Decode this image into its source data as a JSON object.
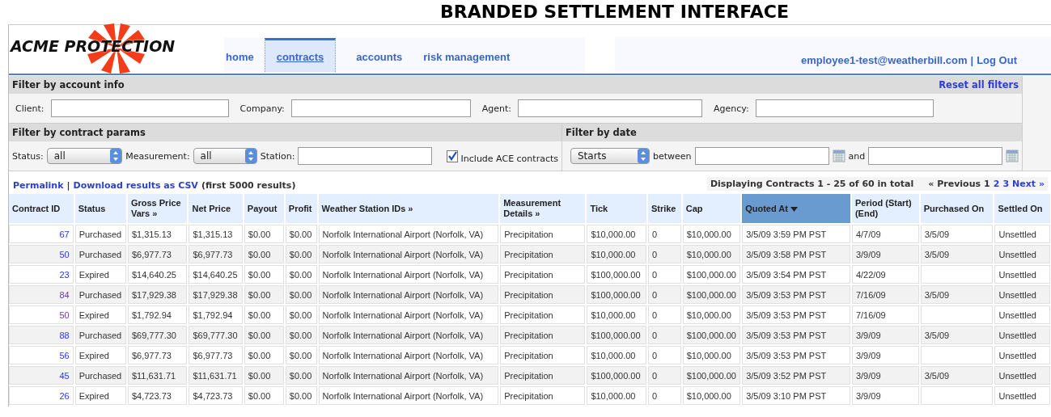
{
  "page_title": "BRANDED SETTLEMENT INTERFACE",
  "header": {
    "logo": "ACME PROTECTION",
    "tabs": [
      {
        "label": "home",
        "selected": false
      },
      {
        "label": "contracts",
        "selected": true
      },
      {
        "label": "accounts",
        "selected": false
      },
      {
        "label": "risk management",
        "selected": false
      }
    ],
    "user": "employee1-test@weatherbill.com",
    "logout": "Log Out"
  },
  "account_filter": {
    "title": "Filter by account info",
    "reset": "Reset all filters",
    "fields": [
      {
        "label": "Client:"
      },
      {
        "label": "Company:"
      },
      {
        "label": "Agent:"
      },
      {
        "label": "Agency:"
      }
    ]
  },
  "contract_filter": {
    "title": "Filter by contract params",
    "status_label": "Status:",
    "status_value": "all",
    "measurement_label": "Measurement:",
    "measurement_value": "all",
    "station_label": "Station:",
    "include_label": "Include ACE contracts",
    "include_checked": true
  },
  "date_filter": {
    "title": "Filter by date",
    "mode": "Starts",
    "between": "between",
    "and": "and"
  },
  "results": {
    "permalink": "Permalink",
    "separator": "|",
    "download": "Download results as CSV",
    "note": "(first 5000 results)",
    "summary": "Displaying Contracts 1 - 25 of 60 in total",
    "pages": [
      {
        "label": "« Previous",
        "link": false
      },
      {
        "label": "1",
        "link": false
      },
      {
        "label": "2",
        "link": true
      },
      {
        "label": "3",
        "link": true
      },
      {
        "label": "Next »",
        "link": true
      }
    ]
  },
  "table": {
    "columns": [
      {
        "label": "Contract ID",
        "selected": false
      },
      {
        "label": "Status",
        "selected": false
      },
      {
        "label": "Gross Price Vars »",
        "selected": false
      },
      {
        "label": "Net Price",
        "selected": false
      },
      {
        "label": "Payout",
        "selected": false
      },
      {
        "label": "Profit",
        "selected": false
      },
      {
        "label": "Weather Station IDs »",
        "selected": false
      },
      {
        "label": "Measurement Details »",
        "selected": false
      },
      {
        "label": "Tick",
        "selected": false
      },
      {
        "label": "Strike",
        "selected": false
      },
      {
        "label": "Cap",
        "selected": false
      },
      {
        "label": "Quoted At",
        "selected": true
      },
      {
        "label": "Period (Start) (End)",
        "selected": false
      },
      {
        "label": "Purchased On",
        "selected": false
      },
      {
        "label": "Settled On",
        "selected": false
      }
    ],
    "rows": [
      {
        "visited": false,
        "cells": [
          "67",
          "Purchased",
          "$1,315.13",
          "$1,315.13",
          "$0.00",
          "$0.00",
          "Norfolk International Airport (Norfolk, VA)",
          "Precipitation",
          "$10,000.00",
          "0",
          "$10,000.00",
          "3/5/09 3:59 PM PST",
          "4/7/09",
          "3/5/09",
          "Unsettled"
        ]
      },
      {
        "visited": false,
        "cells": [
          "50",
          "Purchased",
          "$6,977.73",
          "$6,977.73",
          "$0.00",
          "$0.00",
          "Norfolk International Airport (Norfolk, VA)",
          "Precipitation",
          "$10,000.00",
          "0",
          "$10,000.00",
          "3/5/09 3:58 PM PST",
          "3/9/09",
          "3/5/09",
          "Unsettled"
        ]
      },
      {
        "visited": false,
        "cells": [
          "23",
          "Expired",
          "$14,640.25",
          "$14,640.25",
          "$0.00",
          "$0.00",
          "Norfolk International Airport (Norfolk, VA)",
          "Precipitation",
          "$100,000.00",
          "0",
          "$100,000.00",
          "3/5/09 3:54 PM PST",
          "4/22/09",
          "",
          "Unsettled"
        ]
      },
      {
        "visited": true,
        "cells": [
          "84",
          "Purchased",
          "$17,929.38",
          "$17,929.38",
          "$0.00",
          "$0.00",
          "Norfolk International Airport (Norfolk, VA)",
          "Precipitation",
          "$100,000.00",
          "0",
          "$100,000.00",
          "3/5/09 3:53 PM PST",
          "7/16/09",
          "3/5/09",
          "Unsettled"
        ]
      },
      {
        "visited": true,
        "cells": [
          "50",
          "Expired",
          "$1,792.94",
          "$1,792.94",
          "$0.00",
          "$0.00",
          "Norfolk International Airport (Norfolk, VA)",
          "Precipitation",
          "$10,000.00",
          "0",
          "$10,000.00",
          "3/5/09 3:53 PM PST",
          "7/16/09",
          "",
          "Unsettled"
        ]
      },
      {
        "visited": false,
        "cells": [
          "88",
          "Purchased",
          "$69,777.30",
          "$69,777.30",
          "$0.00",
          "$0.00",
          "Norfolk International Airport (Norfolk, VA)",
          "Precipitation",
          "$100,000.00",
          "0",
          "$100,000.00",
          "3/5/09 3:53 PM PST",
          "3/9/09",
          "3/5/09",
          "Unsettled"
        ]
      },
      {
        "visited": false,
        "cells": [
          "56",
          "Expired",
          "$6,977.73",
          "$6,977.73",
          "$0.00",
          "$0.00",
          "Norfolk International Airport (Norfolk, VA)",
          "Precipitation",
          "$10,000.00",
          "0",
          "$10,000.00",
          "3/5/09 3:53 PM PST",
          "3/9/09",
          "",
          "Unsettled"
        ]
      },
      {
        "visited": false,
        "cells": [
          "45",
          "Purchased",
          "$11,631.71",
          "$11,631.71",
          "$0.00",
          "$0.00",
          "Norfolk International Airport (Norfolk, VA)",
          "Precipitation",
          "$100,000.00",
          "0",
          "$100,000.00",
          "3/5/09 3:52 PM PST",
          "3/9/09",
          "3/5/09",
          "Unsettled"
        ]
      },
      {
        "visited": false,
        "cells": [
          "26",
          "Expired",
          "$4,723.73",
          "$4,723.73",
          "$0.00",
          "$0.00",
          "Norfolk International Airport (Norfolk, VA)",
          "Precipitation",
          "$10,000.00",
          "0",
          "$10,000.00",
          "3/5/09 3:10 PM PST",
          "3/9/09",
          "",
          "Unsettled"
        ]
      }
    ]
  }
}
